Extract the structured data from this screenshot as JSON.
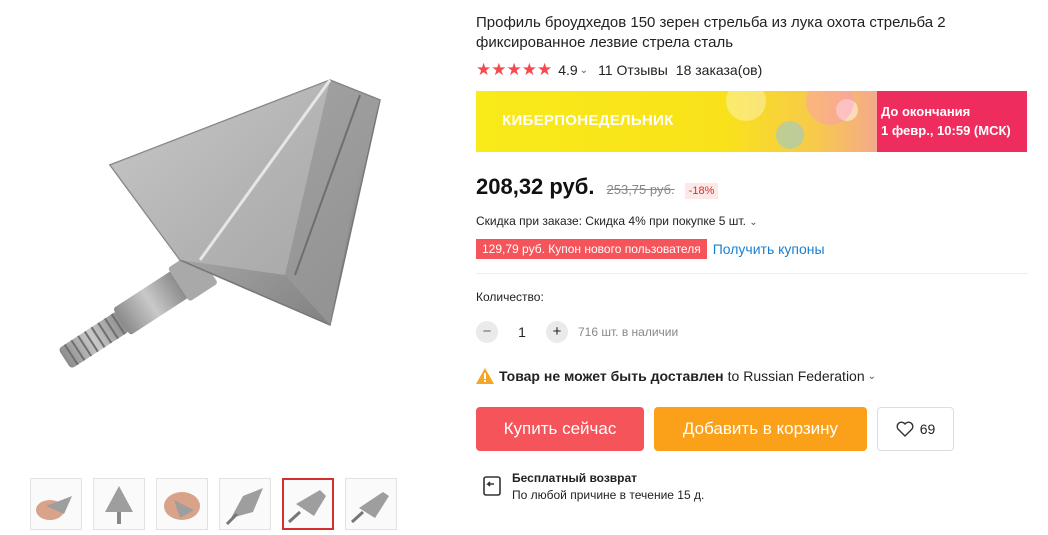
{
  "product": {
    "title": "Профиль броудхедов 150 зерен стрельба из лука охота стрельба 2 фиксированное лезвие стрела сталь",
    "rating": "4.9",
    "stars": "★★★★★",
    "reviews": "11 Отзывы",
    "orders": "18 заказа(ов)"
  },
  "banner": {
    "label": "КИБЕРПОНЕДЕЛЬНИК",
    "until_label": "До окончания",
    "until_date": "1 февр., 10:59 (МСК)"
  },
  "price": {
    "current": "208,32 руб.",
    "old": "253,75 руб.",
    "discount": "-18%"
  },
  "bulk_discount": "Скидка при заказе: Скидка 4% при покупке 5 шт.",
  "coupon": {
    "text": "129,79 руб. Купон нового пользователя",
    "link": "Получить купоны"
  },
  "quantity": {
    "label": "Количество:",
    "value": "1",
    "minus": "−",
    "plus": "+",
    "stock": "716 шт. в наличии"
  },
  "shipping": {
    "bold": "Товар не может быть доставлен",
    "rest": "to Russian Federation"
  },
  "buttons": {
    "buy": "Купить сейчас",
    "cart": "Добавить в корзину",
    "wishlist_count": "69"
  },
  "returns": {
    "title": "Бесплатный возврат",
    "subtitle": "По любой причине в течение 15 д."
  },
  "thumbnails": [
    "thumb-1",
    "thumb-2",
    "thumb-3",
    "thumb-4",
    "thumb-5",
    "thumb-6"
  ],
  "colors": {
    "accent_red": "#f4545a",
    "cart_orange": "#fba019",
    "link_blue": "#1a7fd1",
    "banner_pink": "#ee2d5e",
    "banner_yellow": "#f9ea1a"
  }
}
